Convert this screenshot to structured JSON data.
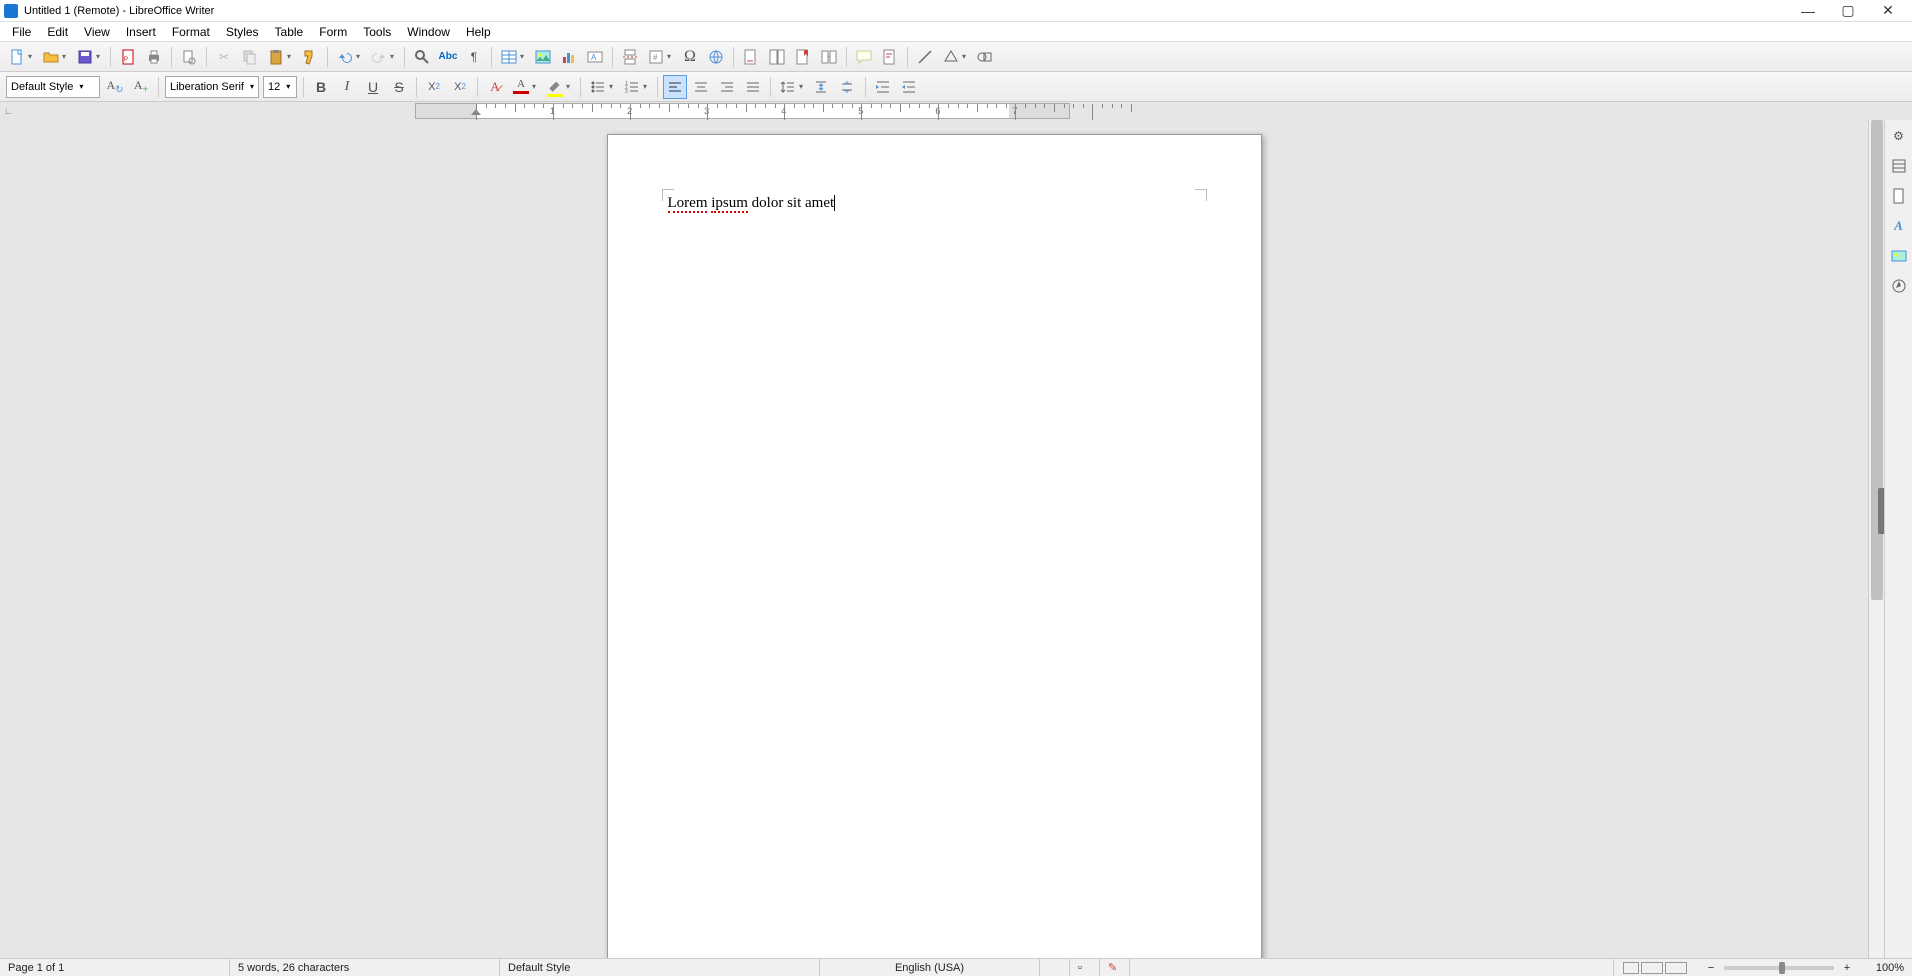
{
  "title": "Untitled 1 (Remote) - LibreOffice Writer",
  "menu": [
    "File",
    "Edit",
    "View",
    "Insert",
    "Format",
    "Styles",
    "Table",
    "Form",
    "Tools",
    "Window",
    "Help"
  ],
  "format": {
    "paragraph_style": "Default Style",
    "font_name": "Liberation Serif",
    "font_size": "12"
  },
  "document": {
    "text_spellcheck_parts": [
      "Lorem",
      " ",
      "ipsum",
      " dolor sit amet"
    ],
    "spellcheck_flags": [
      true,
      false,
      true,
      false
    ]
  },
  "ruler": {
    "numbers": [
      "1",
      "2",
      "3",
      "4",
      "5",
      "6",
      "7"
    ]
  },
  "status": {
    "page": "Page 1 of 1",
    "words": "5 words, 26 characters",
    "style": "Default Style",
    "lang": "English (USA)",
    "zoom": "100%"
  }
}
